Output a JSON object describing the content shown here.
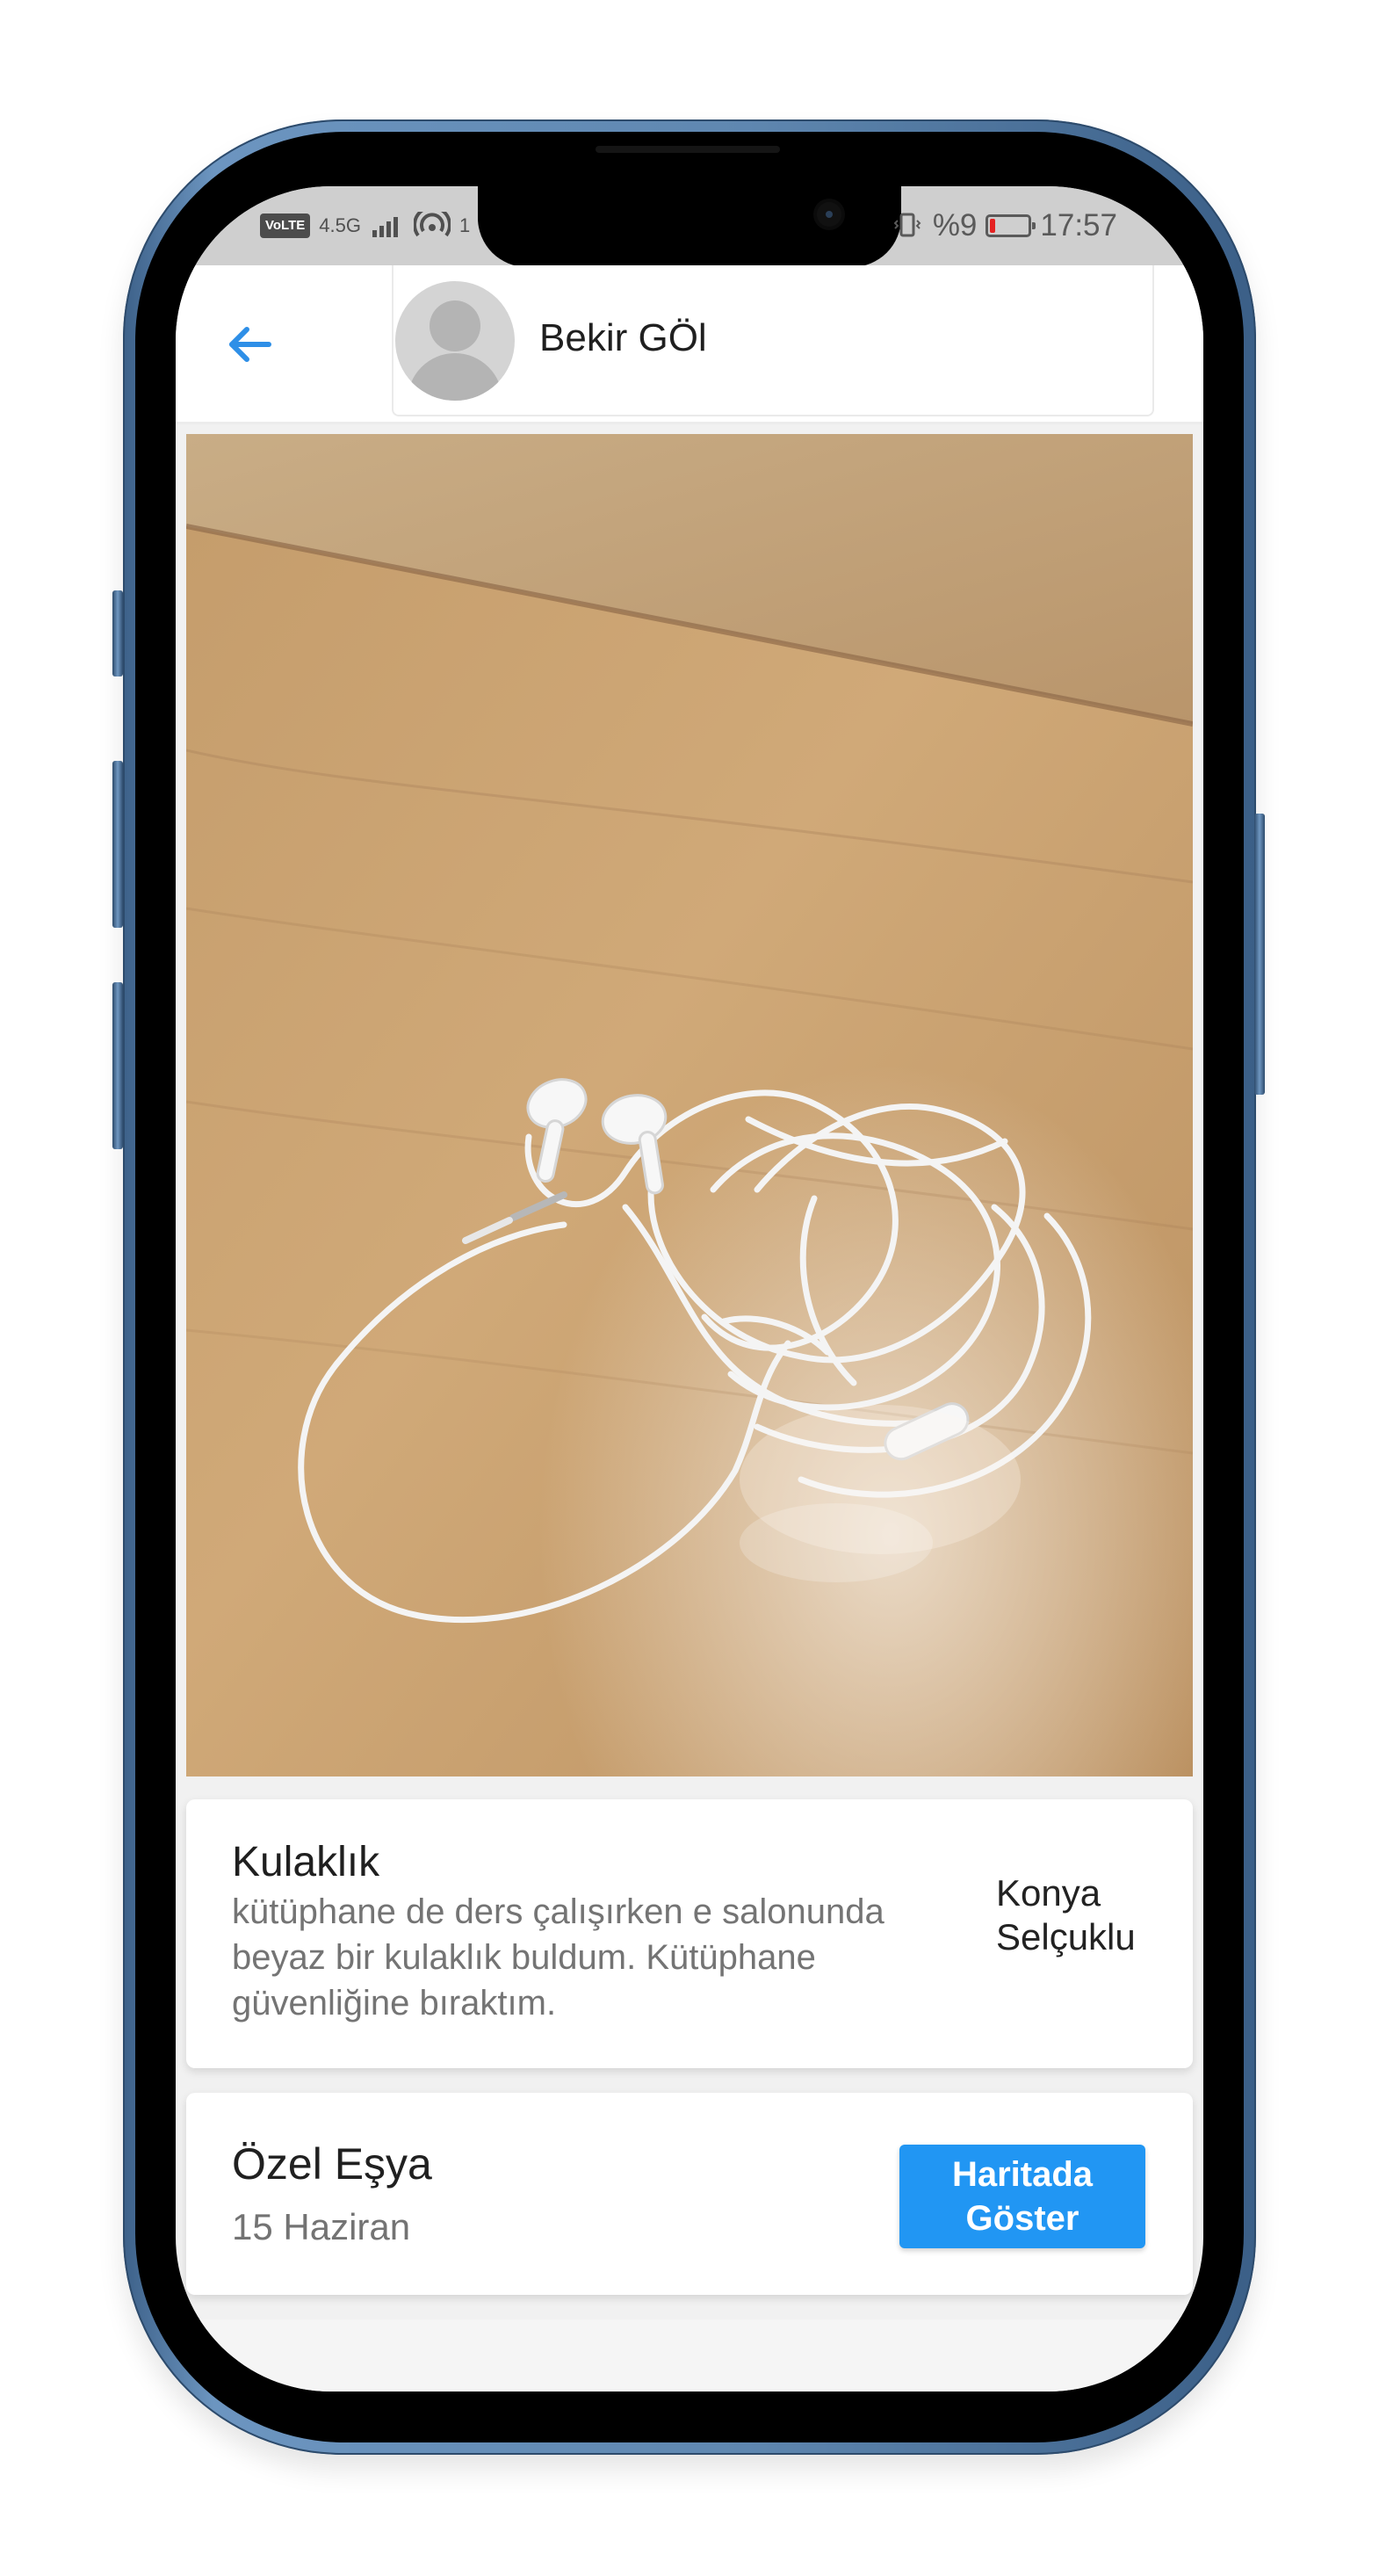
{
  "status_bar": {
    "network_badge": "VoLTE",
    "network_type": "4.5G",
    "hotspot_count": "1",
    "battery_percent": "%9",
    "time": "17:57"
  },
  "header": {
    "back_icon": "arrow-left-icon",
    "user_name": "Bekir GÖl"
  },
  "item": {
    "title": "Kulaklık",
    "description": "kütüphane de ders çalışırken e salonunda beyaz bir kulaklık buldum. Kütüphane güvenliğine bıraktım.",
    "location": "Konya Selçuklu",
    "category": "Özel Eşya",
    "date": "15 Haziran",
    "map_button_label": "Haritada Göster"
  },
  "colors": {
    "accent": "#2196f3",
    "status_bar": "#cfcfcf",
    "frame": "#5f87b0"
  }
}
